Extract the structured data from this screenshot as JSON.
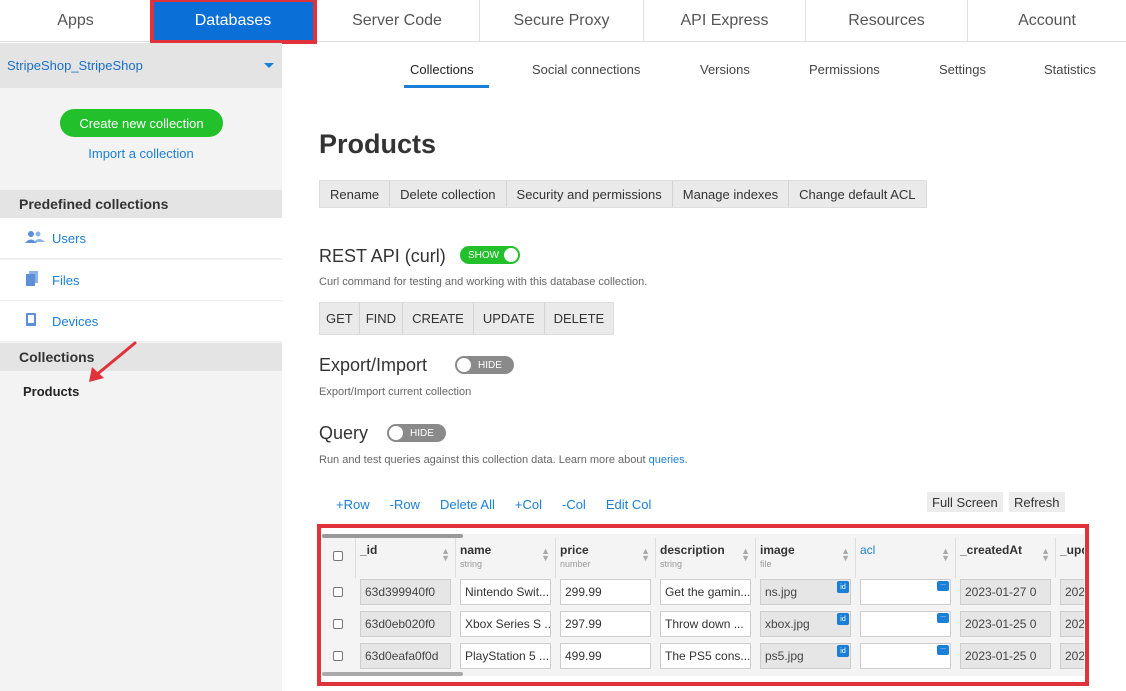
{
  "topnav": {
    "tabs": [
      {
        "label": "Apps"
      },
      {
        "label": "Databases"
      },
      {
        "label": "Server Code"
      },
      {
        "label": "Secure Proxy"
      },
      {
        "label": "API Express"
      },
      {
        "label": "Resources"
      },
      {
        "label": "Account"
      }
    ],
    "active": "Databases"
  },
  "sidebar": {
    "app_name": "StripeShop_StripeShop",
    "create_button": "Create new collection",
    "import_link": "Import a collection",
    "predefined_heading": "Predefined collections",
    "predefined_items": [
      {
        "label": "Users",
        "icon": "users-icon"
      },
      {
        "label": "Files",
        "icon": "files-icon"
      },
      {
        "label": "Devices",
        "icon": "device-icon"
      }
    ],
    "collections_heading": "Collections",
    "collections": [
      "Products"
    ]
  },
  "subnav": {
    "tabs": [
      "Collections",
      "Social connections",
      "Versions",
      "Permissions",
      "Settings",
      "Statistics"
    ],
    "active": "Collections"
  },
  "main": {
    "title": "Products",
    "actions": [
      "Rename",
      "Delete collection",
      "Security and permissions",
      "Manage indexes",
      "Change default ACL"
    ],
    "rest": {
      "title": "REST API (curl)",
      "toggle": "SHOW",
      "desc": "Curl command for testing and working with this database collection.",
      "methods": [
        "GET",
        "FIND",
        "CREATE",
        "UPDATE",
        "DELETE"
      ]
    },
    "export": {
      "title": "Export/Import",
      "toggle": "HIDE",
      "desc": "Export/Import current collection"
    },
    "query": {
      "title": "Query",
      "toggle": "HIDE",
      "desc": "Run and test queries against this collection data. Learn more about ",
      "link": "queries",
      "desc_end": "."
    },
    "table_actions": [
      "+Row",
      "-Row",
      "Delete All",
      "+Col",
      "-Col",
      "Edit Col"
    ],
    "full_screen": "Full Screen",
    "refresh": "Refresh"
  },
  "grid": {
    "columns": [
      {
        "name": "_id",
        "type": ""
      },
      {
        "name": "name",
        "type": "string"
      },
      {
        "name": "price",
        "type": "number"
      },
      {
        "name": "description",
        "type": "string"
      },
      {
        "name": "image",
        "type": "file"
      },
      {
        "name": "acl",
        "type": ""
      },
      {
        "name": "_createdAt",
        "type": ""
      },
      {
        "name": "_upd",
        "type": ""
      }
    ],
    "rows": [
      {
        "id": "63d399940f0",
        "name": "Nintendo Swit...",
        "price": "299.99",
        "description": "Get the gamin...",
        "image": "ns.jpg",
        "acl": "",
        "created": "2023-01-27 0",
        "updated": "202"
      },
      {
        "id": "63d0eb020f0",
        "name": "Xbox Series S ...",
        "price": "297.99",
        "description": "Throw down  ...",
        "image": "xbox.jpg",
        "acl": "",
        "created": "2023-01-25 0",
        "updated": "202"
      },
      {
        "id": "63d0eafa0f0d",
        "name": "PlayStation 5 ...",
        "price": "499.99",
        "description": "The PS5 cons...",
        "image": "ps5.jpg",
        "acl": "",
        "created": "2023-01-25 0",
        "updated": "202"
      }
    ],
    "file_badge": "id",
    "acl_badge": "..."
  },
  "colors": {
    "primary": "#0a6fd6",
    "link": "#1a7fd6",
    "green": "#22c12c",
    "highlight": "#e0323a"
  }
}
